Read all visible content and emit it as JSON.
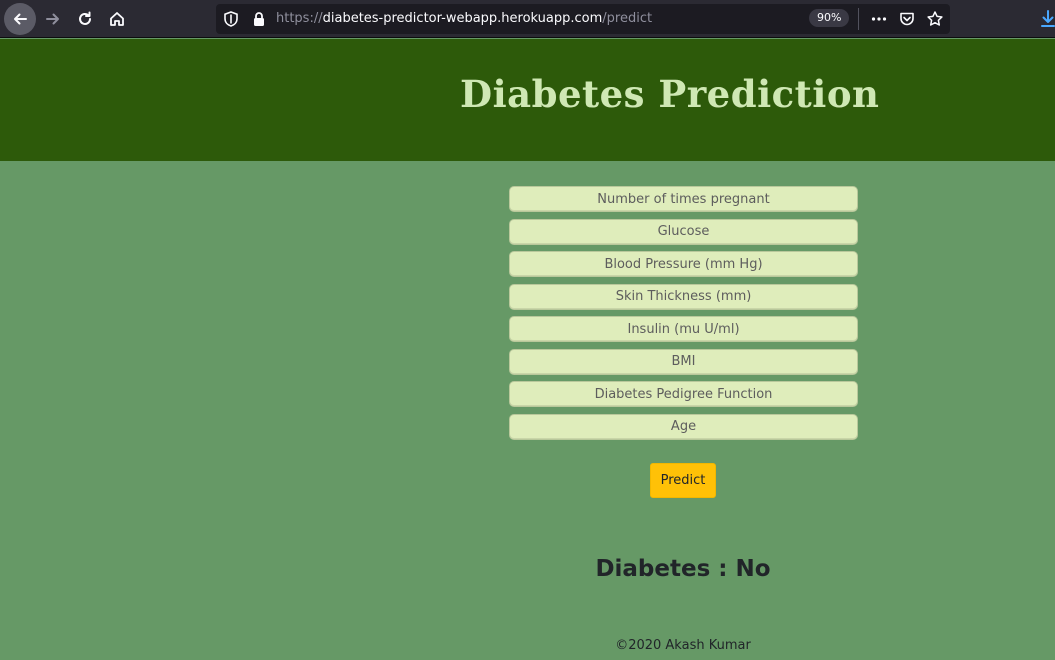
{
  "browser": {
    "url_prefix": "https://",
    "url_domain": "diabetes-predictor-webapp.herokuapp.com",
    "url_path": "/predict",
    "zoom": "90%",
    "icons": [
      "back-icon",
      "forward-icon",
      "reload-icon",
      "home-icon",
      "shield-icon",
      "lock-icon",
      "more-icon",
      "pocket-icon",
      "star-icon",
      "download-icon"
    ]
  },
  "header": {
    "title": "Diabetes Prediction",
    "bg_color": "#2d5a0a",
    "title_color": "#cfe8b4"
  },
  "form": {
    "fields": [
      {
        "placeholder": "Number of times pregnant",
        "value": ""
      },
      {
        "placeholder": "Glucose",
        "value": ""
      },
      {
        "placeholder": "Blood Pressure (mm Hg)",
        "value": ""
      },
      {
        "placeholder": "Skin Thickness (mm)",
        "value": ""
      },
      {
        "placeholder": "Insulin (mu U/ml)",
        "value": ""
      },
      {
        "placeholder": "BMI",
        "value": ""
      },
      {
        "placeholder": "Diabetes Pedigree Function",
        "value": ""
      },
      {
        "placeholder": "Age",
        "value": ""
      }
    ],
    "submit_label": "Predict",
    "submit_color": "#ffc107"
  },
  "result": {
    "text": "Diabetes : No"
  },
  "footer": {
    "text": "©2020 Akash Kumar"
  },
  "colors": {
    "page_bg": "#669966",
    "field_bg": "#dfedbb"
  }
}
